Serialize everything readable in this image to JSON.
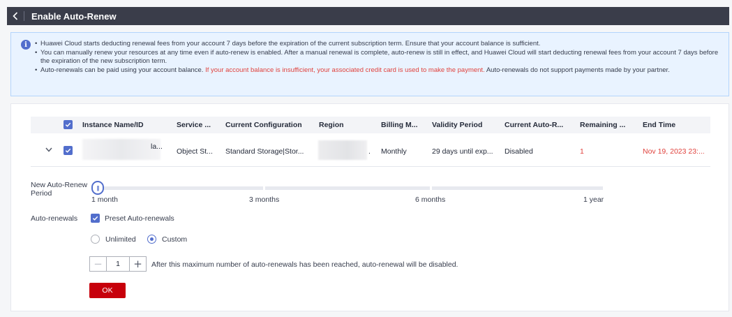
{
  "header": {
    "title": "Enable Auto-Renew"
  },
  "notice": {
    "items": [
      {
        "text": "Huawei Cloud starts deducting renewal fees from your account 7 days before the expiration of the current subscription term. Ensure that your account balance is sufficient."
      },
      {
        "text": "You can manually renew your resources at any time even if auto-renew is enabled. After a manual renewal is complete, auto-renew is still in effect, and Huawei Cloud will start deducting renewal fees from your account 7 days before the expiration of the new subscription term."
      },
      {
        "pre": "Auto-renewals can be paid using your account balance. ",
        "warn": "If your account balance is insufficient, your associated credit card is used to make the payment.",
        "post": " Auto-renewals do not support payments made by your partner."
      }
    ]
  },
  "table": {
    "headers": [
      "Instance Name/ID",
      "Service ...",
      "Current Configuration",
      "Region",
      "Billing M...",
      "Validity Period",
      "Current Auto-R...",
      "Remaining ...",
      "End Time"
    ],
    "row": {
      "name_fragment": "la...",
      "service": "Object St...",
      "configuration": "Standard Storage|Stor...",
      "region_suffix": ".",
      "billing": "Monthly",
      "validity": "29 days until exp...",
      "auto_renew": "Disabled",
      "remaining": "1",
      "end_time": "Nov 19, 2023 23:..."
    }
  },
  "period": {
    "label_line1": "New Auto-Renew",
    "label_line2": "Period",
    "ticks": [
      "1 month",
      "3 months",
      "6 months",
      "1 year"
    ],
    "selected": "1 month"
  },
  "renewals": {
    "label": "Auto-renewals",
    "preset_label": "Preset Auto-renewals",
    "preset_checked": true,
    "options": [
      "Unlimited",
      "Custom"
    ],
    "selected_option": "Custom",
    "count": "1",
    "hint": "After this maximum number of auto-renewals has been reached, auto-renewal will be disabled."
  },
  "ok_label": "OK",
  "colors": {
    "accent": "#526ecc",
    "primary_button": "#c7000b",
    "warning_text": "#e0423d",
    "header_bg": "#3a3d4a"
  }
}
